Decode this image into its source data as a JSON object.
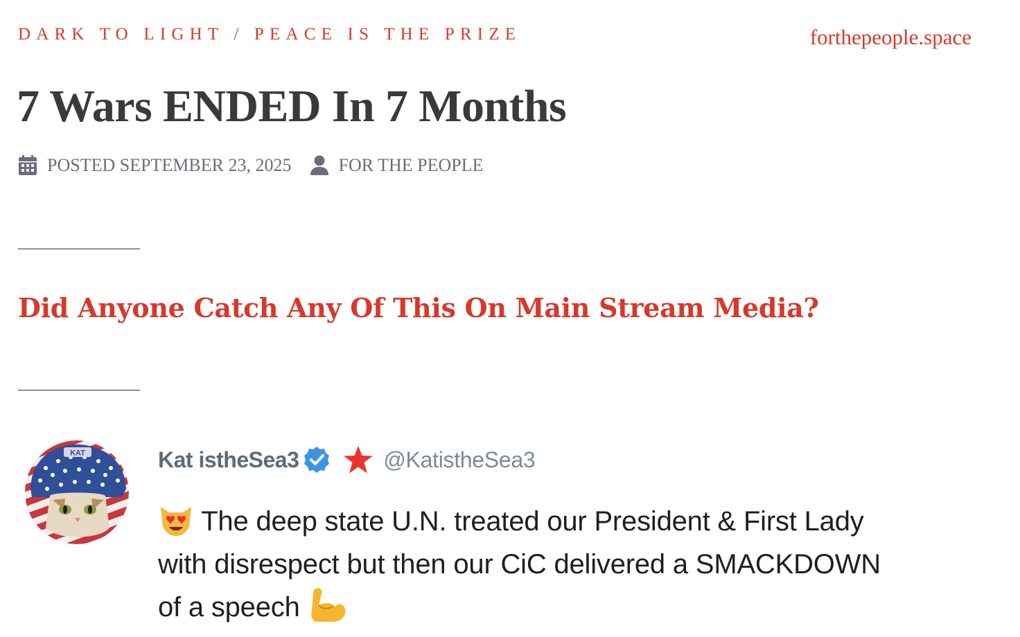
{
  "header": {
    "tagline": "DARK TO LIGHT / PEACE IS THE PRIZE",
    "site": "forthepeople.space"
  },
  "post": {
    "title": "7 Wars ENDED In 7 Months",
    "posted": "POSTED SEPTEMBER 23, 2025",
    "author": "FOR THE PEOPLE",
    "subhead": "Did Anyone Catch Any Of This On Main Stream Media?"
  },
  "tweet": {
    "name": "Kat istheSea3",
    "handle": "@KatistheSea3",
    "avatar_hat_text": "KAT",
    "line1": "The deep state U.N. treated our President & First Lady",
    "line2": "with disrespect but then our CiC delivered a SMACKDOWN",
    "line3": "of a speech"
  },
  "icons": {
    "calendar": "calendar-icon",
    "author": "user-icon",
    "verified": "verified-badge-icon",
    "star": "star-icon",
    "emoji_start": "heart-eyes-cat-emoji",
    "emoji_end": "flexed-biceps-emoji"
  },
  "colors": {
    "accent": "#d6392b",
    "title": "#3a3a3a",
    "meta": "#6c6c7c",
    "verified": "#3b94e6",
    "star": "#e8352b"
  }
}
